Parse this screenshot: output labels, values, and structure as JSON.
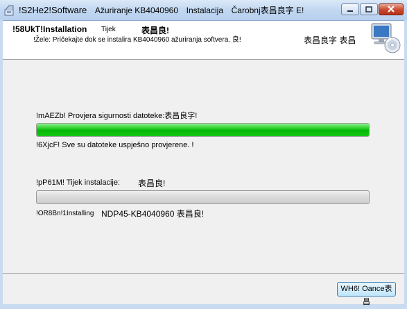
{
  "window": {
    "title_parts": [
      "!S2He2!Software",
      "Ažuriranje KB4040960",
      "Instalacija",
      "Čarobnj表昌良字 E!"
    ]
  },
  "header": {
    "title": "!58UkT!Installation",
    "phase": "Tijek",
    "cjk": "表昌良!",
    "description": "!Žele: Pričekajte dok se instalira KB4040960 ažuriranja softvera. 良!",
    "right_text": "表昌良字 表昌"
  },
  "verify": {
    "label": "!mAEZb! Provjera sigurnosti datoteke:表昌良字!",
    "progress": 1.0,
    "status": "!6XjcF! Sve su datoteke uspješno provjerene. !"
  },
  "install": {
    "label": "!pP61M! Tijek instalacije:",
    "label_cjk": "表昌良!",
    "progress": 0.0,
    "status_prefix": "!OR8Bn!1Installing",
    "status_item": "NDP45-KB4040960 表昌良!"
  },
  "footer": {
    "cancel_label": "WH6! Oance表昌"
  },
  "colors": {
    "progress_green": "#06b806",
    "title_bar": "#c2d8f1",
    "close_button": "#c8472c"
  }
}
